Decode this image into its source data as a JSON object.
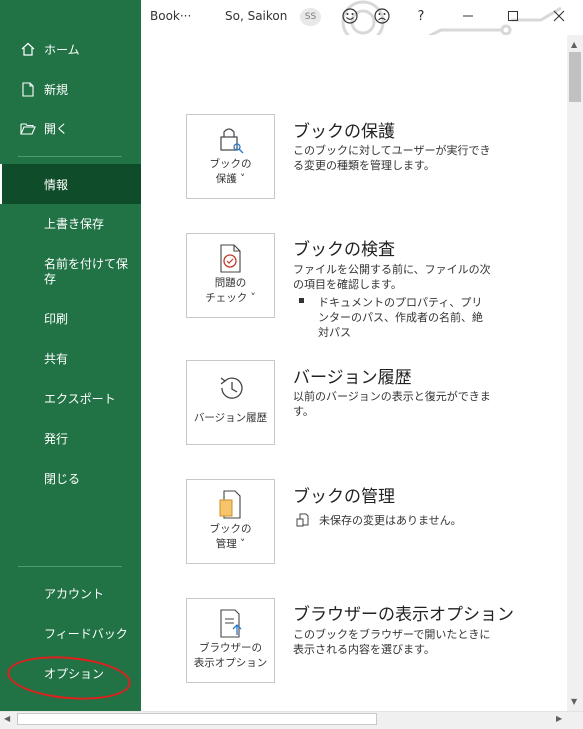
{
  "titlebar": {
    "doc_name": "Book···",
    "user_name": "So, Saikon",
    "user_initials": "SS",
    "smile_icon": "smile-icon",
    "frown_icon": "frown-icon",
    "help": "?",
    "minimize_icon": "minimize-icon",
    "maximize_icon": "maximize-icon",
    "close_icon": "close-icon"
  },
  "sidebar": {
    "top_items": [
      {
        "label": "ホーム",
        "icon": "home-icon"
      },
      {
        "label": "新規",
        "icon": "new-doc-icon"
      },
      {
        "label": "開く",
        "icon": "folder-open-icon"
      }
    ],
    "items": [
      {
        "label": "情報",
        "active": true
      },
      {
        "label": "上書き保存"
      },
      {
        "label": "名前を付けて保存"
      },
      {
        "label": "印刷"
      },
      {
        "label": "共有"
      },
      {
        "label": "エクスポート"
      },
      {
        "label": "発行"
      },
      {
        "label": "閉じる"
      }
    ],
    "bottom_items": [
      {
        "label": "アカウント"
      },
      {
        "label": "フィードバック"
      },
      {
        "label": "オプション"
      }
    ],
    "accent": "#217346",
    "highlight_color": "#e0201c"
  },
  "sections": [
    {
      "button_label_1": "ブックの",
      "button_label_2": "保護 ˅",
      "icon": "lock-icon",
      "title": "ブックの保護",
      "desc": "このブックに対してユーザーが実行できる変更の種類を管理します。"
    },
    {
      "button_label_1": "問題の",
      "button_label_2": "チェック ˅",
      "icon": "inspect-icon",
      "title": "ブックの検査",
      "desc": "ファイルを公開する前に、ファイルの次の項目を確認します。",
      "bullet": "ドキュメントのプロパティ、プリンターのパス、作成者の名前、絶対パス"
    },
    {
      "button_label_1": "バージョン履歴",
      "icon": "history-icon",
      "title": "バージョン履歴",
      "desc": "以前のバージョンの表示と復元ができます。"
    },
    {
      "button_label_1": "ブックの",
      "button_label_2": "管理 ˅",
      "icon": "manage-workbook-icon",
      "title": "ブックの管理",
      "status_icon": "unsaved-icon",
      "desc": "未保存の変更はありません。"
    },
    {
      "button_label_1": "ブラウザーの",
      "button_label_2": "表示オプション",
      "icon": "browser-options-icon",
      "title": "ブラウザーの表示オプション",
      "desc": "このブックをブラウザーで開いたときに表示される内容を選びます。"
    }
  ]
}
